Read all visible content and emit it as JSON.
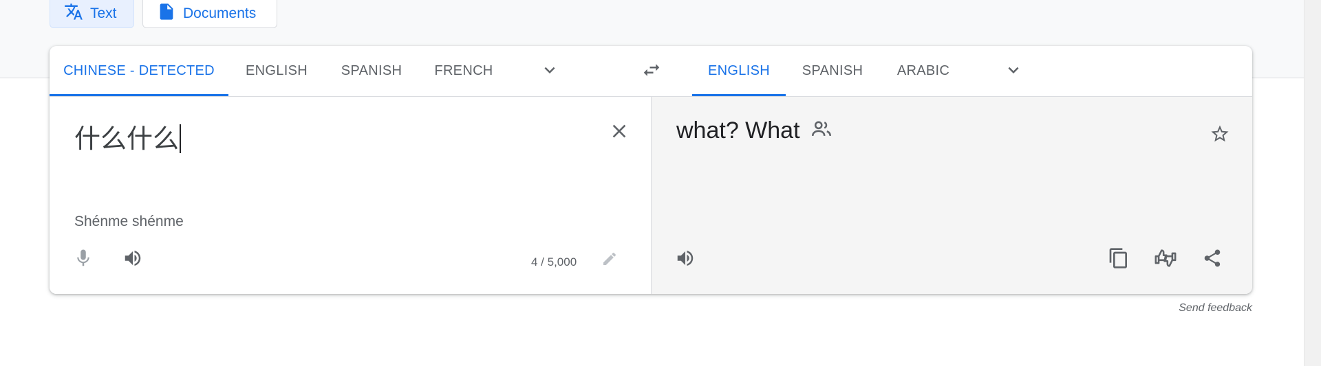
{
  "mode_tabs": {
    "text_label": "Text",
    "documents_label": "Documents"
  },
  "source_languages": {
    "tabs": [
      "CHINESE - DETECTED",
      "ENGLISH",
      "SPANISH",
      "FRENCH"
    ],
    "active_index": 0
  },
  "target_languages": {
    "tabs": [
      "ENGLISH",
      "SPANISH",
      "ARABIC"
    ],
    "active_index": 0
  },
  "source": {
    "text": "什么什么",
    "transliteration": "Shénme shénme",
    "char_count": "4 / 5,000"
  },
  "target": {
    "text": "what? What"
  },
  "footer": {
    "send_feedback": "Send feedback"
  },
  "icons": {
    "text_mode": "translate-icon",
    "documents_mode": "document-icon",
    "more_source_langs": "chevron-down-icon",
    "swap": "swap-icon",
    "more_target_langs": "chevron-down-icon",
    "clear": "close-icon",
    "mic": "mic-icon",
    "listen_source": "speaker-icon",
    "edit": "pencil-icon",
    "gender": "people-icon",
    "star": "star-icon",
    "listen_target": "speaker-icon",
    "copy": "copy-icon",
    "rate": "thumbs-icon",
    "share": "share-icon"
  },
  "colors": {
    "accent": "#1a73e8",
    "icon": "#5f6368",
    "target_bg": "#f5f5f5"
  }
}
